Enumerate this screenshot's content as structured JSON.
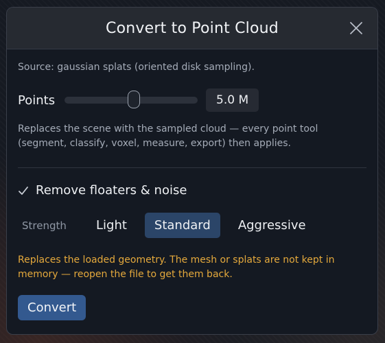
{
  "dialog": {
    "title": "Convert to Point Cloud",
    "close_icon": "close-icon"
  },
  "source_text": "Source: gaussian splats (oriented disk sampling).",
  "points": {
    "label": "Points",
    "slider_fraction": 0.52,
    "value": "5.0 M"
  },
  "points_description": "Replaces the scene with the sampled cloud — every point tool (segment, classify, voxel, measure, export) then applies.",
  "remove_floaters": {
    "checked": true,
    "label": "Remove floaters & noise"
  },
  "strength": {
    "label": "Strength",
    "options": [
      "Light",
      "Standard",
      "Aggressive"
    ],
    "selected": "Standard"
  },
  "warning": "Replaces the loaded geometry. The mesh or splats are not kept in memory — reopen the file to get them back.",
  "convert_button": "Convert",
  "colors": {
    "accent": "#33598f",
    "selected_segment": "#2b4568",
    "warning": "#e5a93c"
  }
}
